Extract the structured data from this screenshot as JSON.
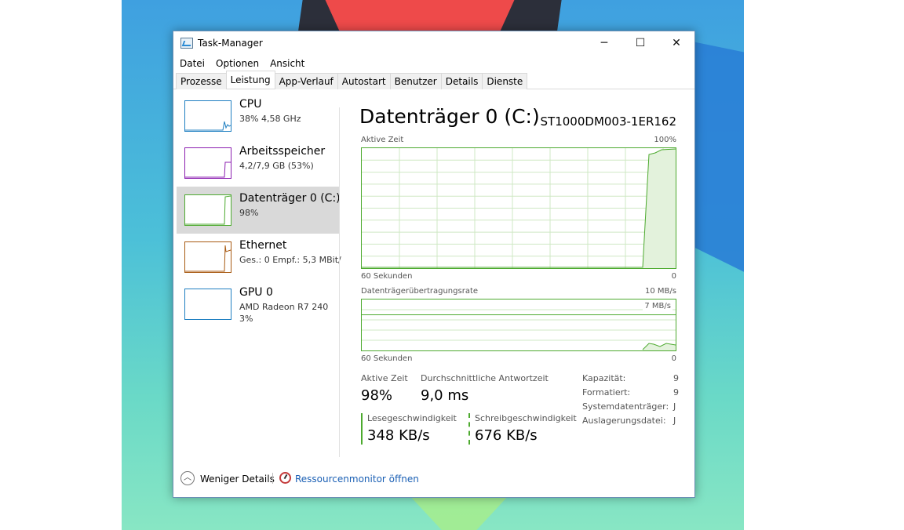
{
  "window": {
    "title": "Task-Manager",
    "controls": {
      "minimize": "─",
      "maximize": "☐",
      "close": "✕"
    }
  },
  "menu": [
    "Datei",
    "Optionen",
    "Ansicht"
  ],
  "tabs": [
    "Prozesse",
    "Leistung",
    "App-Verlauf",
    "Autostart",
    "Benutzer",
    "Details",
    "Dienste"
  ],
  "active_tab": "Leistung",
  "resources": [
    {
      "name": "CPU",
      "sub": "38% 4,58 GHz",
      "sub2": "",
      "color": "#1f7fc1",
      "selected": false
    },
    {
      "name": "Arbeitsspeicher",
      "sub": "4,2/7,9 GB (53%)",
      "sub2": "",
      "color": "#8b1fb0",
      "selected": false
    },
    {
      "name": "Datenträger 0 (C:)",
      "sub": "98%",
      "sub2": "",
      "color": "#4daa2f",
      "selected": true
    },
    {
      "name": "Ethernet",
      "sub": "Ges.: 0  Empf.: 5,3 MBit/",
      "sub2": "",
      "color": "#a85a12",
      "selected": false
    },
    {
      "name": "GPU 0",
      "sub": "AMD Radeon R7 240",
      "sub2": "3%",
      "color": "#1f7fc1",
      "selected": false
    }
  ],
  "detail": {
    "title": "Datenträger 0 (C:)",
    "model": "ST1000DM003-1ER162",
    "graph1": {
      "label": "Aktive Zeit",
      "max": "100%",
      "xlabel": "60 Sekunden",
      "xmin": "0"
    },
    "graph2": {
      "label": "Datenträgerübertragungsrate",
      "max": "10 MB/s",
      "marker": "7 MB/s",
      "xlabel": "60 Sekunden",
      "xmin": "0"
    },
    "stats": {
      "active_time_label": "Aktive Zeit",
      "active_time_value": "98%",
      "avg_response_label": "Durchschnittliche Antwortzeit",
      "avg_response_value": "9,0 ms",
      "read_label": "Lesegeschwindigkeit",
      "read_value": "348 KB/s",
      "write_label": "Schreibgeschwindigkeit",
      "write_value": "676 KB/s"
    },
    "properties": [
      {
        "key": "Kapazität:",
        "value": "9"
      },
      {
        "key": "Formatiert:",
        "value": "9"
      },
      {
        "key": "Systemdatenträger:",
        "value": "J"
      },
      {
        "key": "Auslagerungsdatei:",
        "value": "J"
      }
    ]
  },
  "footer": {
    "less_details": "Weniger Details",
    "resource_monitor": "Ressourcenmonitor öffnen"
  },
  "colors": {
    "disk": "#4daa2f",
    "cpu": "#1f7fc1",
    "memory": "#8b1fb0",
    "ethernet": "#a85a12"
  }
}
